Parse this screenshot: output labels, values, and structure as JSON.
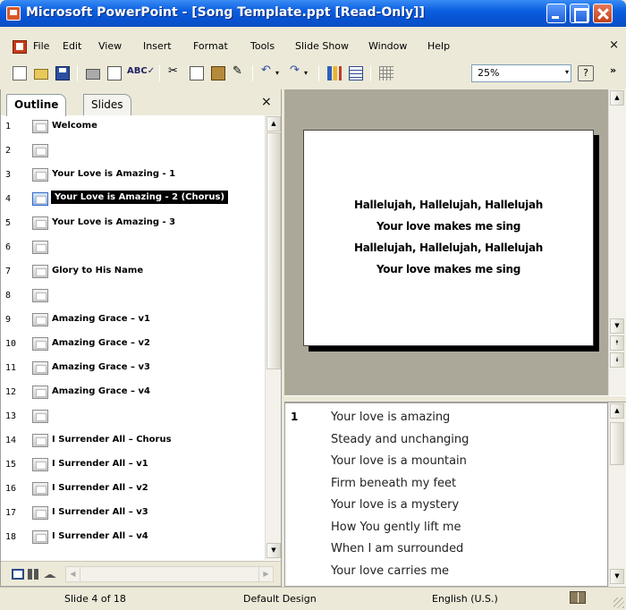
{
  "window": {
    "title": "Microsoft PowerPoint - [Song Template.ppt [Read-Only]]"
  },
  "menu": {
    "items": [
      "File",
      "Edit",
      "View",
      "Insert",
      "Format",
      "Tools",
      "Slide Show",
      "Window",
      "Help"
    ],
    "close": "×"
  },
  "toolbar": {
    "zoom": "25%",
    "help_glyph": "?",
    "more_glyph": "»",
    "spell_glyph": "ABC✓",
    "cut_glyph": "✂",
    "undo_glyph": "↶",
    "redo_glyph": "↷",
    "brush_glyph": "✎",
    "dropdown_glyph": "▾",
    "icons": [
      "new-icon",
      "open-icon",
      "save-icon",
      "print-icon",
      "print-preview-icon",
      "spelling-icon",
      "cut-icon",
      "copy-icon",
      "paste-icon",
      "format-painter-icon",
      "undo-icon",
      "redo-icon",
      "chart-icon",
      "table-icon",
      "grid-icon"
    ]
  },
  "left_pane": {
    "tabs": [
      "Outline",
      "Slides"
    ],
    "close": "×",
    "slides": [
      {
        "num": "1",
        "title": "Welcome"
      },
      {
        "num": "2",
        "title": ""
      },
      {
        "num": "3",
        "title": "Your Love is Amazing - 1"
      },
      {
        "num": "4",
        "title": "Your Love is Amazing - 2 (Chorus)",
        "selected": true
      },
      {
        "num": "5",
        "title": "Your Love is Amazing - 3"
      },
      {
        "num": "6",
        "title": ""
      },
      {
        "num": "7",
        "title": "Glory to His Name"
      },
      {
        "num": "8",
        "title": ""
      },
      {
        "num": "9",
        "title": "Amazing Grace – v1"
      },
      {
        "num": "10",
        "title": "Amazing Grace – v2"
      },
      {
        "num": "11",
        "title": "Amazing Grace – v3"
      },
      {
        "num": "12",
        "title": "Amazing Grace – v4"
      },
      {
        "num": "13",
        "title": ""
      },
      {
        "num": "14",
        "title": "I Surrender All – Chorus"
      },
      {
        "num": "15",
        "title": "I Surrender All – v1"
      },
      {
        "num": "16",
        "title": "I Surrender All – v2"
      },
      {
        "num": "17",
        "title": "I Surrender All – v3"
      },
      {
        "num": "18",
        "title": "I Surrender All – v4"
      }
    ]
  },
  "slide": {
    "lines": [
      "Hallelujah, Hallelujah, Hallelujah",
      "Your love makes me sing",
      "Hallelujah, Hallelujah, Hallelujah",
      "Your love makes me sing"
    ]
  },
  "notes": {
    "number": "1",
    "lines": [
      "Your love is amazing",
      "Steady and unchanging",
      "Your love is a mountain",
      "Firm beneath my feet",
      "Your love is a mystery",
      "How You gently lift me",
      "When I am surrounded",
      "Your love carries me"
    ]
  },
  "status": {
    "slide_position": "Slide 4 of 18",
    "design": "Default Design",
    "language": "English (U.S.)"
  }
}
